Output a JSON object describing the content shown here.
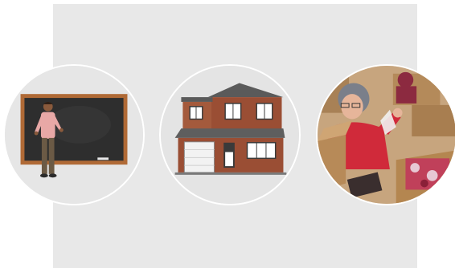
{
  "images": [
    {
      "subject": "teacher-at-chalkboard-illustration"
    },
    {
      "subject": "two-story-brick-house-illustration"
    },
    {
      "subject": "woman-packing-boxes-photo"
    }
  ]
}
